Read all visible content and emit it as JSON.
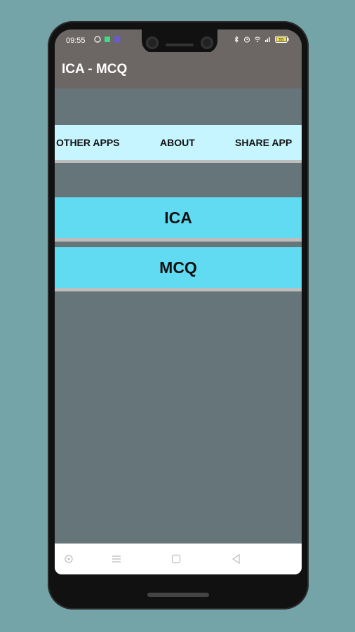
{
  "status": {
    "time": "09:55",
    "battery": "55",
    "left_icons": [
      "whatsapp-icon",
      "message-icon",
      "ai-icon"
    ],
    "right_icons": [
      "bluetooth-icon",
      "alarm-icon",
      "wifi-icon",
      "signal-icon",
      "battery-icon"
    ]
  },
  "appbar": {
    "title": "ICA - MCQ"
  },
  "menu": {
    "items": [
      {
        "label": "OTHER APPS"
      },
      {
        "label": "ABOUT"
      },
      {
        "label": "SHARE APP"
      }
    ]
  },
  "main": {
    "buttons": [
      {
        "label": "ICA"
      },
      {
        "label": "MCQ"
      }
    ]
  },
  "colors": {
    "background": "#74a3a8",
    "appbar": "#6c6764",
    "screen": "#66757a",
    "menu_strip": "#c6f4ff",
    "button": "#60dbf2"
  }
}
